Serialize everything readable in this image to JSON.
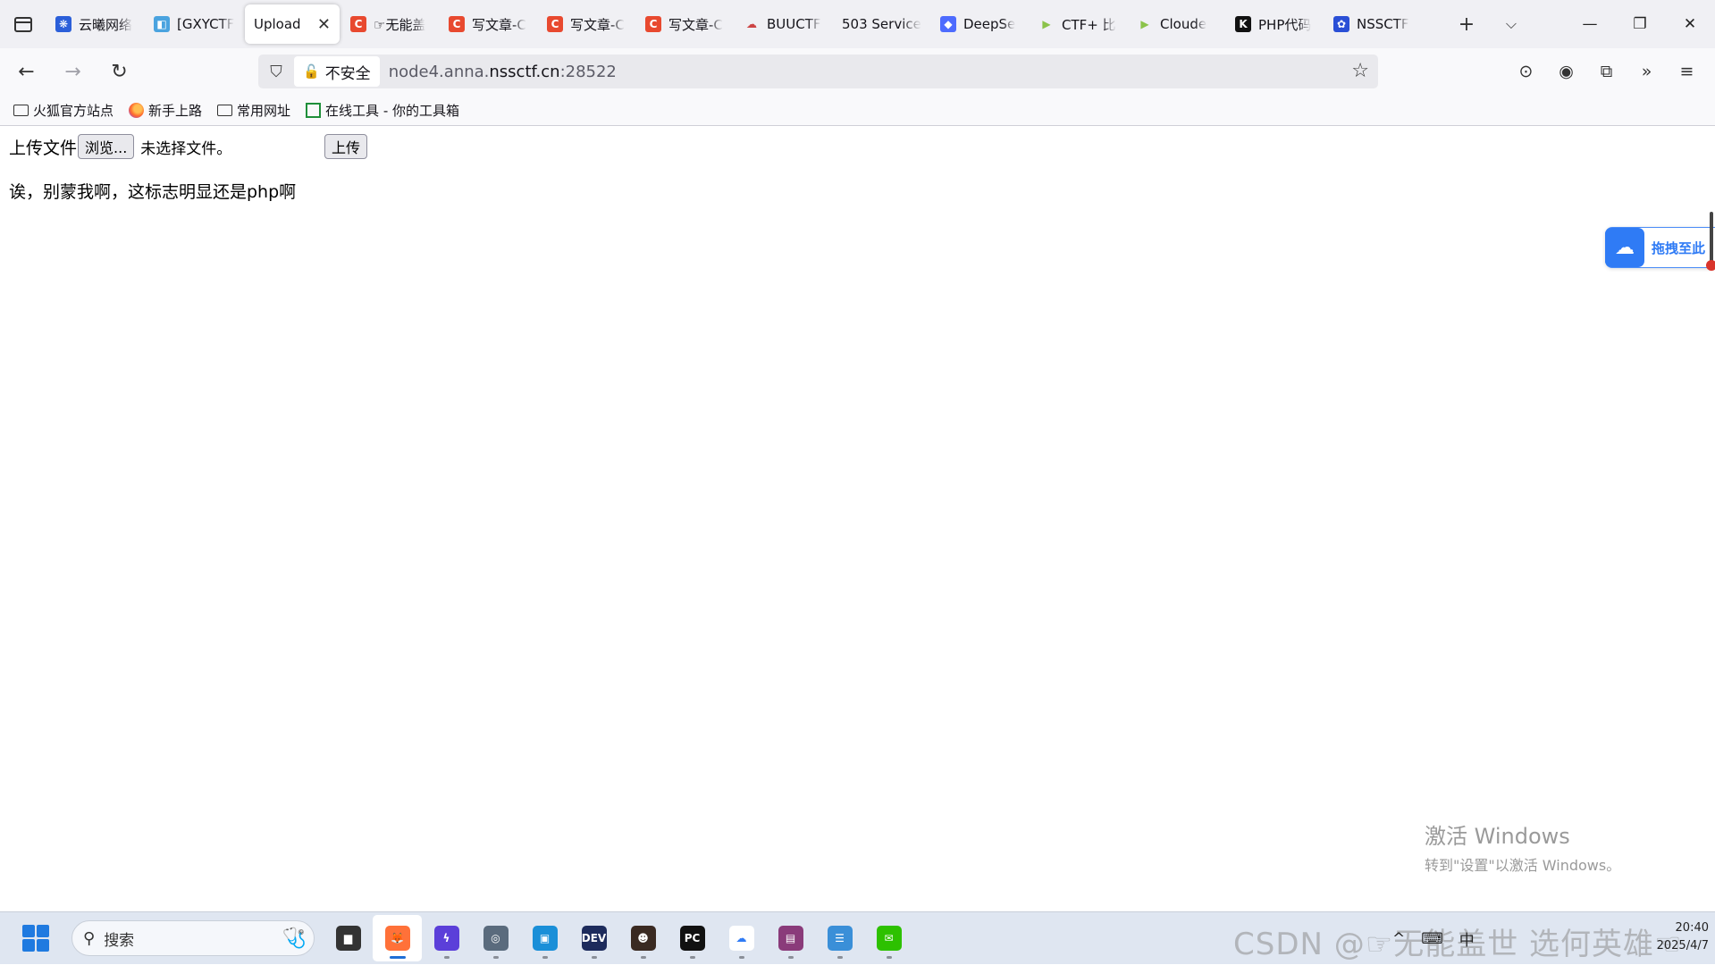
{
  "tabs": [
    {
      "title": "云曦网络",
      "color": "#2b5fd9",
      "letter": "❋"
    },
    {
      "title": "[GXYCTF",
      "color": "#4aa3df",
      "letter": "◧"
    },
    {
      "title": "Upload",
      "active": true
    },
    {
      "title": "☞无能盖",
      "color": "#e8492f",
      "letter": "C"
    },
    {
      "title": "写文章-C",
      "color": "#e8492f",
      "letter": "C"
    },
    {
      "title": "写文章-C",
      "color": "#e8492f",
      "letter": "C"
    },
    {
      "title": "写文章-C",
      "color": "#e8492f",
      "letter": "C"
    },
    {
      "title": "BUUCTF",
      "color": "#ffffff",
      "letter": "☁"
    },
    {
      "title": "503 Service",
      "color": "#ffffff",
      "letter": ""
    },
    {
      "title": "DeepSe",
      "color": "#4d6bfe",
      "letter": "◆"
    },
    {
      "title": "CTF+ 比",
      "color": "#ffffff",
      "letter": "▶"
    },
    {
      "title": "Cloude",
      "color": "#ffffff",
      "letter": "▶"
    },
    {
      "title": "PHP代码",
      "color": "#111111",
      "letter": "K"
    },
    {
      "title": "NSSCTF",
      "color": "#2a4fd6",
      "letter": "✿"
    }
  ],
  "tabstrip": {
    "new_tab": "+",
    "list_all": "⌵",
    "minimize": "—",
    "restore": "❐",
    "close": "✕",
    "active_close": "✕"
  },
  "nav": {
    "back": "←",
    "forward": "→",
    "reload": "↻",
    "shield": "⛉",
    "insecure_label": "不安全",
    "url_prefix": "node4.anna.",
    "url_domain": "nssctf.cn",
    "url_suffix": ":28522",
    "bookmark_star": "☆"
  },
  "toolbar_icons": [
    "pocket-icon",
    "account-icon",
    "extensions-icon",
    "overflow-icon",
    "menu-icon"
  ],
  "bookmarks": [
    {
      "label": "火狐官方站点",
      "icon": "folder"
    },
    {
      "label": "新手上路",
      "icon": "firefox"
    },
    {
      "label": "常用网址",
      "icon": "folder"
    },
    {
      "label": "在线工具 - 你的工具箱",
      "icon": "tool"
    }
  ],
  "page": {
    "upload_label": "上传文件",
    "browse_button": "浏览...",
    "no_file_text": "未选择文件。",
    "submit_button": "上传",
    "result_message": "诶，别蒙我啊，这标志明显还是php啊"
  },
  "drag_widget": {
    "label": "拖拽至此"
  },
  "watermark": {
    "activate_title": "激活 Windows",
    "activate_hint": "转到\"设置\"以激活 Windows。",
    "csdn": "CSDN @☞无能盖世  选何英雄☜"
  },
  "taskbar": {
    "search_placeholder": "搜索",
    "apps": [
      {
        "name": "file-explorer",
        "bg": "#333333",
        "glyph": "▆"
      },
      {
        "name": "firefox",
        "bg": "#ff7139",
        "glyph": "🦊",
        "active": true
      },
      {
        "name": "app-purple",
        "bg": "#5b3fd9",
        "glyph": "ϟ"
      },
      {
        "name": "app-compass",
        "bg": "#5a6b7d",
        "glyph": "◎"
      },
      {
        "name": "app-vm",
        "bg": "#1a8fd8",
        "glyph": "▣"
      },
      {
        "name": "dev-cpp",
        "bg": "#1d2b5c",
        "glyph": "DEV"
      },
      {
        "name": "app-avatar",
        "bg": "#3a2a22",
        "glyph": "☻"
      },
      {
        "name": "pycharm",
        "bg": "#111111",
        "glyph": "PC"
      },
      {
        "name": "baidu-netdisk",
        "bg": "#ffffff",
        "glyph": "☁"
      },
      {
        "name": "winrar",
        "bg": "#8a3b7a",
        "glyph": "▤"
      },
      {
        "name": "notepad",
        "bg": "#3a8fd8",
        "glyph": "☰"
      },
      {
        "name": "wechat",
        "bg": "#2dc100",
        "glyph": "✉"
      }
    ],
    "tray": {
      "chevron": "^",
      "ime1": "⌨",
      "ime2": "中",
      "clock_time": "20:40",
      "clock_date": "2025/4/7"
    }
  }
}
